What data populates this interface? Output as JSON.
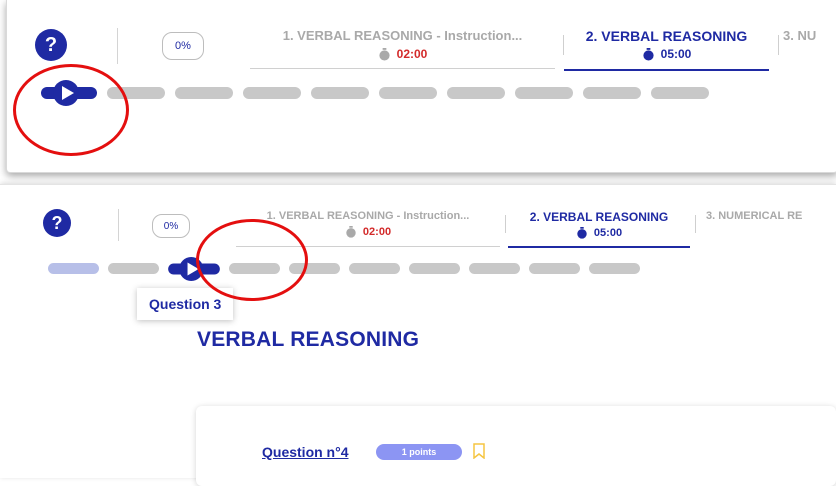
{
  "colors": {
    "brand": "#1f2aa3",
    "timer_red": "#d32a2a",
    "annotation_red": "#e40f0f",
    "segment_gray": "#c8c8c8",
    "segment_done": "#b7bfe8",
    "badge_bg": "#8c95f3",
    "bookmark": "#f5c542"
  },
  "header": {
    "help_icon": "?",
    "progress": "0%",
    "tabs_top": [
      {
        "title": "1. VERBAL REASONING - Instruction...",
        "time": "02:00",
        "state": "inactive",
        "icon": "stopwatch-icon"
      },
      {
        "title": "2. VERBAL REASONING",
        "time": "05:00",
        "state": "active",
        "icon": "stopwatch-icon"
      },
      {
        "title": "3. NU",
        "time": "",
        "state": "inactive",
        "icon": "stopwatch-icon"
      }
    ],
    "tabs_bottom": [
      {
        "title": "1. VERBAL REASONING - Instruction...",
        "time": "02:00",
        "state": "inactive",
        "icon": "stopwatch-icon"
      },
      {
        "title": "2. VERBAL REASONING",
        "time": "05:00",
        "state": "active",
        "icon": "stopwatch-icon"
      },
      {
        "title": "3. NUMERICAL RE",
        "time": "",
        "state": "inactive",
        "icon": "stopwatch-icon"
      }
    ]
  },
  "question_nav_top": {
    "segments": 10,
    "current_index": 0
  },
  "question_nav_bottom": {
    "segments": 10,
    "current_index": 2,
    "done": [
      0
    ]
  },
  "tooltip": {
    "text": "Question 3"
  },
  "main": {
    "section_title": "VERBAL REASONING",
    "question_label": "Question n°4",
    "points_badge": "1 points"
  }
}
